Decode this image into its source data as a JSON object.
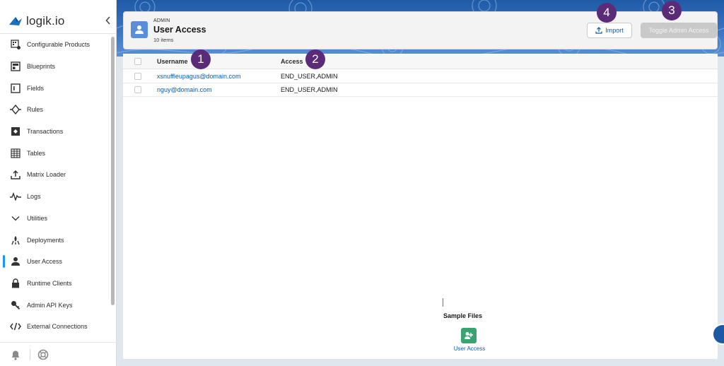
{
  "brand": {
    "name": "logik.io"
  },
  "sidebar": {
    "items": [
      {
        "label": "Configurable Products",
        "icon": "configurable-products-icon"
      },
      {
        "label": "Blueprints",
        "icon": "blueprint-icon"
      },
      {
        "label": "Fields",
        "icon": "fields-icon"
      },
      {
        "label": "Rules",
        "icon": "rules-icon"
      },
      {
        "label": "Transactions",
        "icon": "transactions-icon"
      },
      {
        "label": "Tables",
        "icon": "tables-icon"
      },
      {
        "label": "Matrix Loader",
        "icon": "upload-icon"
      },
      {
        "label": "Logs",
        "icon": "pulse-icon"
      },
      {
        "label": "Utilities",
        "icon": "chevron-down-icon"
      },
      {
        "label": "Deployments",
        "icon": "deployments-icon"
      },
      {
        "label": "User Access",
        "icon": "user-icon",
        "active": true
      },
      {
        "label": "Runtime Clients",
        "icon": "lock-icon"
      },
      {
        "label": "Admin API Keys",
        "icon": "key-icon"
      },
      {
        "label": "External Connections",
        "icon": "code-icon"
      }
    ]
  },
  "header": {
    "eyebrow": "ADMIN",
    "title": "User Access",
    "count": "10 items",
    "import_label": "Import",
    "toggle_label": "Toggle Admin Access"
  },
  "table": {
    "columns": [
      "Username",
      "Access"
    ],
    "rows": [
      {
        "username": "xsnuffleupagus@domain.com",
        "access": "END_USER,ADMIN"
      },
      {
        "username": "nguy@domain.com",
        "access": "END_USER,ADMIN"
      }
    ]
  },
  "sample_files": {
    "title": "Sample Files",
    "item_label": "User Access"
  },
  "annotations": [
    "1",
    "2",
    "3",
    "4"
  ],
  "colors": {
    "accent": "#1b96ff",
    "link": "#0b5cab",
    "badge": "#5b2b7a",
    "header_icon": "#5a8ed8",
    "sample_icon": "#3ba272"
  }
}
